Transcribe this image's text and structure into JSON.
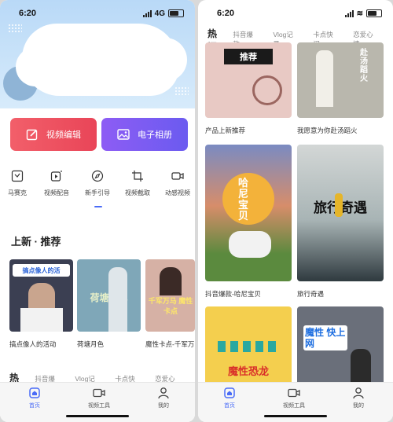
{
  "left": {
    "status": {
      "time": "6:20",
      "network": "4G"
    },
    "buttons": {
      "edit": "视频编辑",
      "album": "电子相册"
    },
    "tools": [
      {
        "label": "马赛克",
        "icon": "mosaic-icon"
      },
      {
        "label": "视频配音",
        "icon": "dub-icon"
      },
      {
        "label": "新手引导",
        "icon": "compass-icon"
      },
      {
        "label": "视频截取",
        "icon": "crop-icon"
      },
      {
        "label": "动感视频",
        "icon": "camera-icon"
      }
    ],
    "section_title": "上新 · 推荐",
    "thumbs": [
      {
        "label": "搞点像人的活动",
        "overlay": "搞点像人的活",
        "bg": "#3b3f52"
      },
      {
        "label": "荷塘月色",
        "overlay": "荷塘月色",
        "bg": "#7fa7b8"
      },
      {
        "label": "魔性卡点-千军万",
        "overlay": "千军万马 魔性卡点",
        "bg": "#d6b1a5"
      }
    ],
    "tabs": [
      "热门",
      "抖音爆款",
      "Vlog记录",
      "卡点快闪",
      "恋爱心情"
    ]
  },
  "right": {
    "status": {
      "time": "6:20"
    },
    "tabs": [
      "热门",
      "抖音爆款",
      "Vlog记录",
      "卡点快闪",
      "恋爱心情"
    ],
    "cards": [
      {
        "caption": "产品上新推荐",
        "overlay": "推荐",
        "bg": "#e8c9c4"
      },
      {
        "caption": "我愿意为你赴汤蹈火",
        "overlay": "赴汤蹈火",
        "bg": "#b9b7ad"
      },
      {
        "caption": "抖音爆款-哈尼宝贝",
        "overlay": "哈尼宝贝",
        "bg": "#c07a4c"
      },
      {
        "caption": "旅行奇遇",
        "overlay": "旅行奇遇",
        "bg": "#bcc6c8"
      },
      {
        "caption": "",
        "overlay": "魔性恐龙",
        "bg": "#f4cf4e"
      },
      {
        "caption": "",
        "overlay": "魔性 快上网",
        "bg": "#6a6f7a"
      }
    ]
  },
  "nav": [
    {
      "label": "首页",
      "icon": "home-icon"
    },
    {
      "label": "视频工具",
      "icon": "video-icon"
    },
    {
      "label": "我的",
      "icon": "user-icon"
    }
  ],
  "colors": {
    "accent": "#4a6cf7",
    "edit": "#ef5363",
    "album": "#7b5df2"
  }
}
